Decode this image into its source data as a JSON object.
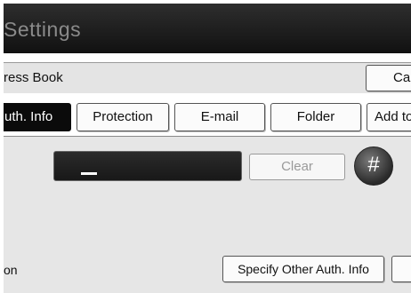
{
  "window": {
    "title": "Settings"
  },
  "address_book": {
    "label": "ress Book",
    "cancel_label": "Car"
  },
  "tabs": [
    {
      "label": "uth. Info",
      "active": true
    },
    {
      "label": "Protection",
      "active": false
    },
    {
      "label": "E-mail",
      "active": false
    },
    {
      "label": "Folder",
      "active": false
    },
    {
      "label": "Add to",
      "active": false
    }
  ],
  "entry": {
    "value": "",
    "clear_label": "Clear",
    "hash_label": "#"
  },
  "footer": {
    "label": "on",
    "specify_label": "Specify Other Auth. Info"
  },
  "colors": {
    "title_bar": "#151515",
    "active_tab": "#0b0b0b",
    "panel": "#e6e6e6"
  }
}
